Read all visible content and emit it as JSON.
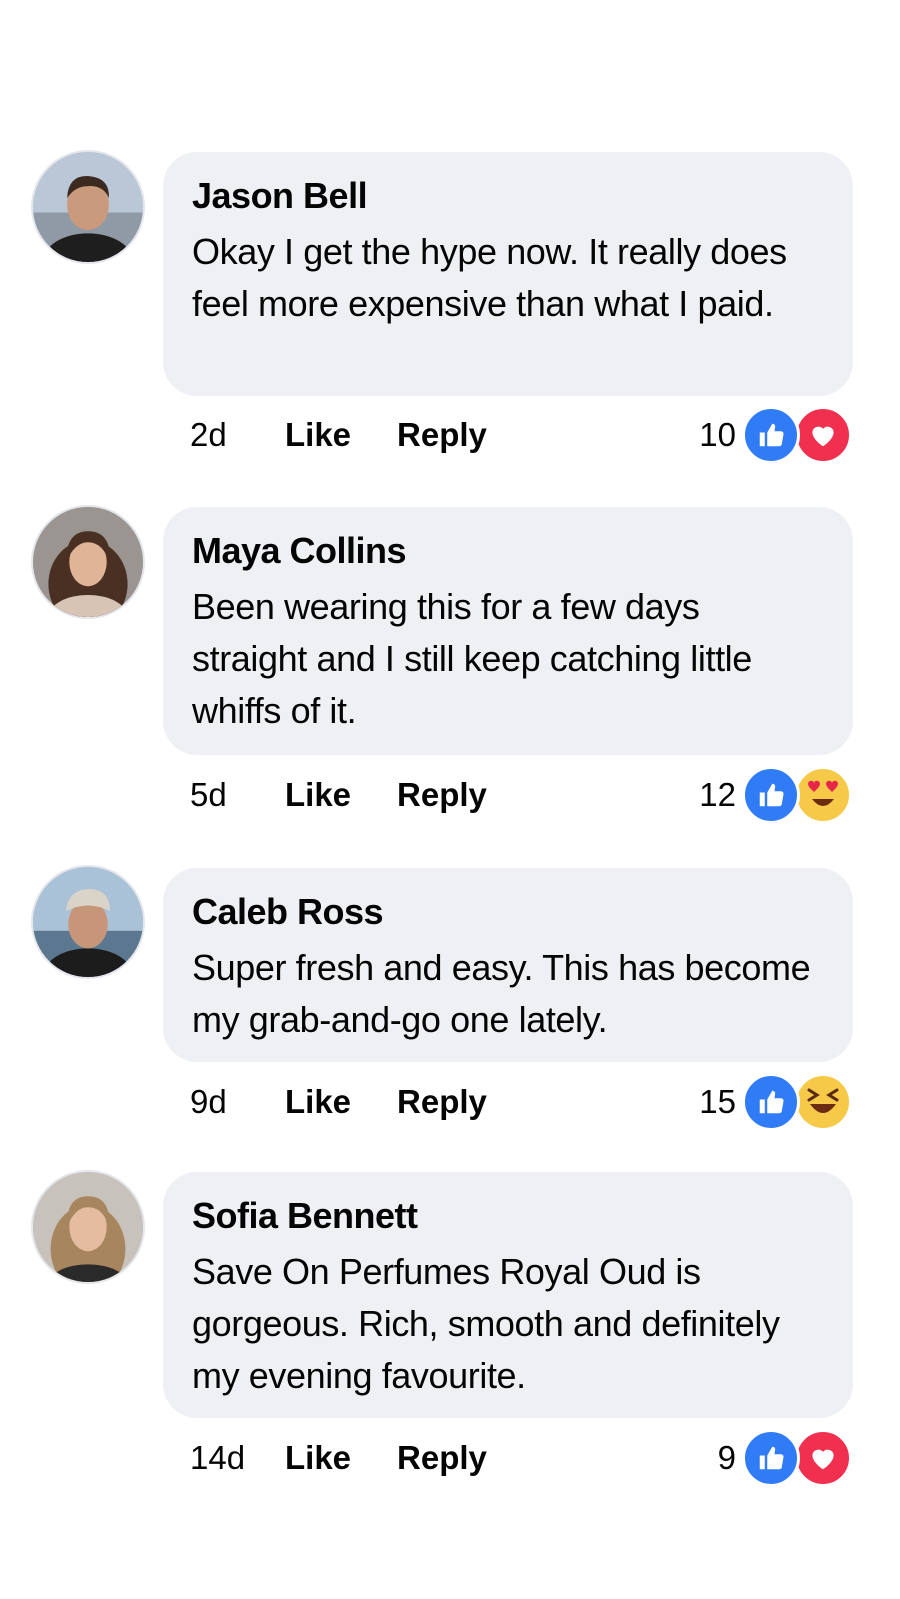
{
  "comments": [
    {
      "author": "Jason Bell",
      "text": "Okay I get the hype now. It really does feel more expensive than what I paid.",
      "time": "2d",
      "like_label": "Like",
      "reply_label": "Reply",
      "reaction_count": "10",
      "reactions": [
        "like-icon",
        "heart-icon"
      ]
    },
    {
      "author": "Maya Collins",
      "text": "Been wearing this for a few days straight and I still keep catching little whiffs of it.",
      "time": "5d",
      "like_label": "Like",
      "reply_label": "Reply",
      "reaction_count": "12",
      "reactions": [
        "like-icon",
        "heart-eyes-icon"
      ]
    },
    {
      "author": "Caleb Ross",
      "text": "Super fresh and easy. This has become my grab-and-go one lately.",
      "time": "9d",
      "like_label": "Like",
      "reply_label": "Reply",
      "reaction_count": "15",
      "reactions": [
        "like-icon",
        "laughing-icon"
      ]
    },
    {
      "author": "Sofia Bennett",
      "text": "Save On Perfumes Royal Oud is gorgeous. Rich, smooth and definitely my evening favourite.",
      "time": "14d",
      "like_label": "Like",
      "reply_label": "Reply",
      "reaction_count": "9",
      "reactions": [
        "like-icon",
        "heart-icon"
      ]
    }
  ],
  "colors": {
    "bubble": "#eef0f4",
    "like": "#2f7cf6",
    "love": "#f0304e",
    "emoji": "#f7c948"
  }
}
